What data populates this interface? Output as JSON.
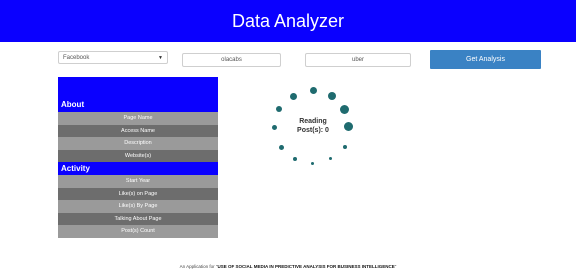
{
  "header": {
    "title": "Data Analyzer"
  },
  "controls": {
    "platform_select": "Facebook",
    "input_one": "olacabs",
    "input_two": "uber",
    "analyze_button": "Get Analysis"
  },
  "about": {
    "heading": "About",
    "items": [
      "Page Name",
      "Access Name",
      "Description",
      "Website(s)"
    ]
  },
  "activity": {
    "heading": "Activity",
    "items": [
      "Start Year",
      "Like(s) on Page",
      "Like(s) By Page",
      "Talking About Page",
      "Post(s) Count"
    ]
  },
  "loader": {
    "line1": "Reading",
    "line2": "Post(s): 0"
  },
  "footer": {
    "prefix": "An Application for \"",
    "emphasis": "USE OF SOCIAL MEDIA IN PREDICTIVE ANALYSIS FOR BUSINESS INTELLIGENCE",
    "suffix": "\""
  },
  "colors": {
    "header_bg": "#0a00ff",
    "button_bg": "#3a82c4",
    "spinner": "#1f6b6f"
  }
}
